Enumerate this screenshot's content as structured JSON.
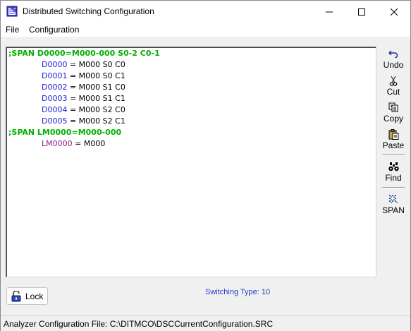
{
  "window": {
    "title": "Distributed Switching Configuration",
    "icon": "app-config-icon",
    "controls": [
      "minimize-icon",
      "maximize-icon",
      "close-icon"
    ]
  },
  "menu": {
    "items": [
      {
        "label": "File"
      },
      {
        "label": "Configuration"
      }
    ]
  },
  "editor": {
    "lines": [
      {
        "kind": "span",
        "text": ";SPAN D0000=M000-000 S0-2 C0-1"
      },
      {
        "kind": "def",
        "name": "D0000",
        "value": " = M000 S0 C0",
        "name_color": "#1c1cd8"
      },
      {
        "kind": "def",
        "name": "D0001",
        "value": " = M000 S0 C1",
        "name_color": "#1c1cd8"
      },
      {
        "kind": "def",
        "name": "D0002",
        "value": " = M000 S1 C0",
        "name_color": "#1c1cd8"
      },
      {
        "kind": "def",
        "name": "D0003",
        "value": " = M000 S1 C1",
        "name_color": "#1c1cd8"
      },
      {
        "kind": "def",
        "name": "D0004",
        "value": " = M000 S2 C0",
        "name_color": "#1c1cd8"
      },
      {
        "kind": "def",
        "name": "D0005",
        "value": " = M000 S2 C1",
        "name_color": "#1c1cd8"
      },
      {
        "kind": "span",
        "text": ";SPAN LM0000=M000-000"
      },
      {
        "kind": "def",
        "name": "LM0000",
        "value": " = M000",
        "name_color": "#8b1a8b"
      }
    ],
    "span_color": "#00b000"
  },
  "toolbar": {
    "undo_label": "Undo",
    "cut_label": "Cut",
    "copy_label": "Copy",
    "paste_label": "Paste",
    "find_label": "Find",
    "span_label": "SPAN"
  },
  "lock": {
    "label": "Lock",
    "icon": "padlock-open-icon"
  },
  "switching": {
    "label": "Switching Type:",
    "value": "10"
  },
  "status": {
    "text": "Analyzer Configuration File: C:\\DITMCO\\DSCCurrentConfiguration.SRC"
  }
}
